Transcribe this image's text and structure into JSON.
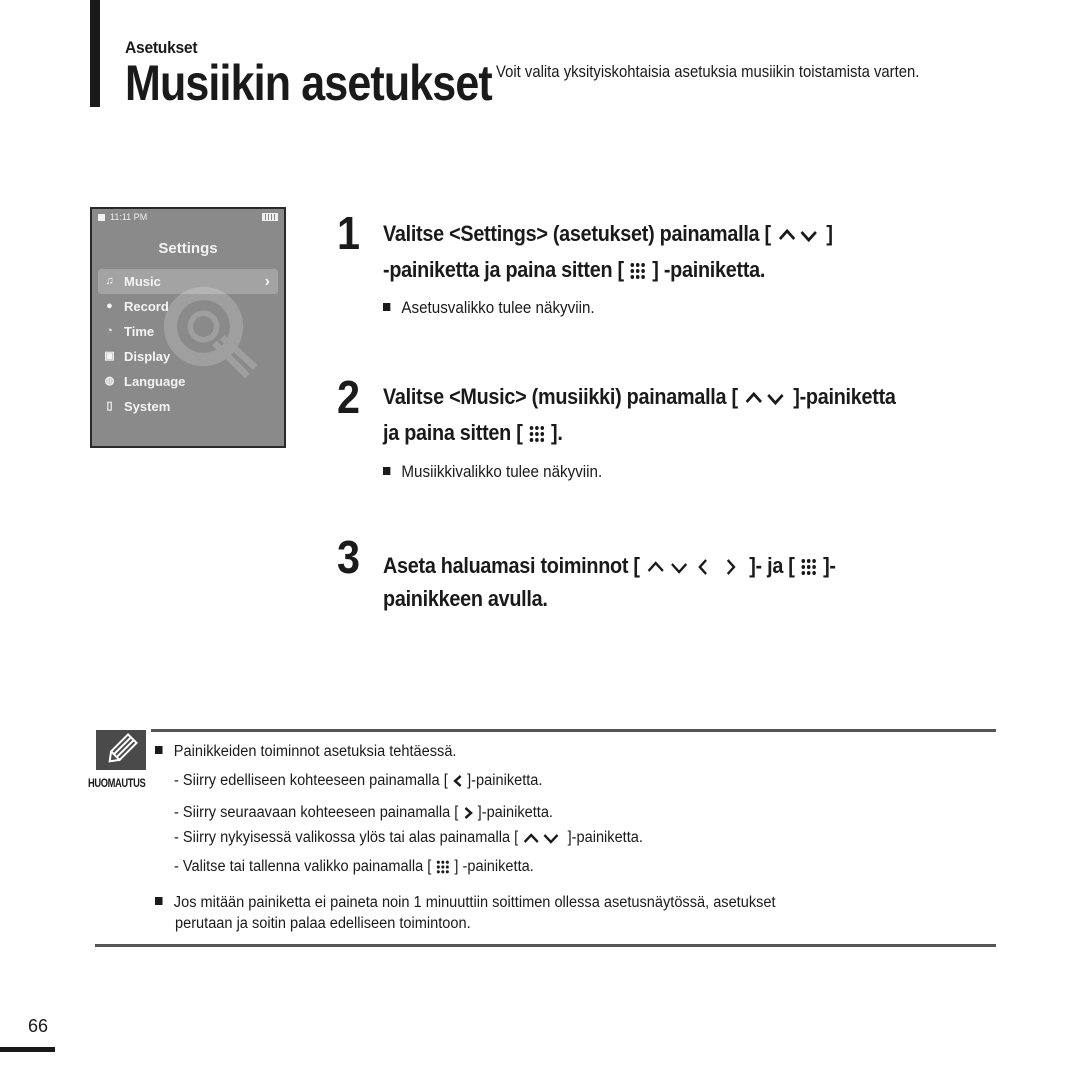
{
  "header": {
    "section": "Asetukset",
    "title": "Musiikin asetukset",
    "description": "Voit valita yksityiskohtaisia asetuksia musiikin toistamista varten."
  },
  "device": {
    "time": "11:11 PM",
    "title": "Settings",
    "menu": [
      {
        "label": "Music",
        "icon": "music-note-icon",
        "selected": true
      },
      {
        "label": "Record",
        "icon": "record-icon",
        "selected": false
      },
      {
        "label": "Time",
        "icon": "clock-icon",
        "selected": false
      },
      {
        "label": "Display",
        "icon": "display-icon",
        "selected": false
      },
      {
        "label": "Language",
        "icon": "globe-icon",
        "selected": false
      },
      {
        "label": "System",
        "icon": "system-icon",
        "selected": false
      }
    ]
  },
  "steps": [
    {
      "number": "1",
      "line1_a": "Valitse <Settings> (asetukset) painamalla [",
      "line1_b": "]",
      "line2_a": "-painiketta ja paina sitten  [",
      "line2_b": "] -painiketta.",
      "note": "Asetusvalikko tulee näkyviin."
    },
    {
      "number": "2",
      "line1_a": "Valitse <Music> (musiikki) painamalla [",
      "line1_b": "]-painiketta",
      "line2_a": "ja paina sitten [",
      "line2_b": "].",
      "note": "Musiikkivalikko tulee näkyviin."
    },
    {
      "number": "3",
      "line1_a": "Aseta haluamasi toiminnot [",
      "line1_b": "]- ja [",
      "line1_c": "]-",
      "line2": "painikkeen avulla."
    }
  ],
  "note": {
    "label": "HUOMAUTUS",
    "heading": "Painikkeiden toiminnot asetuksia tehtäessä.",
    "items": [
      {
        "pre": "- Siirry edelliseen kohteeseen painamalla [",
        "post": "]-painiketta."
      },
      {
        "pre": "- Siirry seuraavaan kohteeseen painamalla [",
        "post": "]-painiketta."
      },
      {
        "pre": "- Siirry nykyisessä valikossa ylös tai alas painamalla [",
        "post": "]-painiketta."
      },
      {
        "pre": "- Valitse tai tallenna valikko painamalla [",
        "post": "] -painiketta."
      }
    ],
    "timeout_line1": "Jos mitään painiketta ei paineta noin 1 minuuttiin soittimen ollessa asetusnäytössä, asetukset",
    "timeout_line2": "perutaan ja soitin palaa edelliseen toimintoon."
  },
  "page_number": "66"
}
